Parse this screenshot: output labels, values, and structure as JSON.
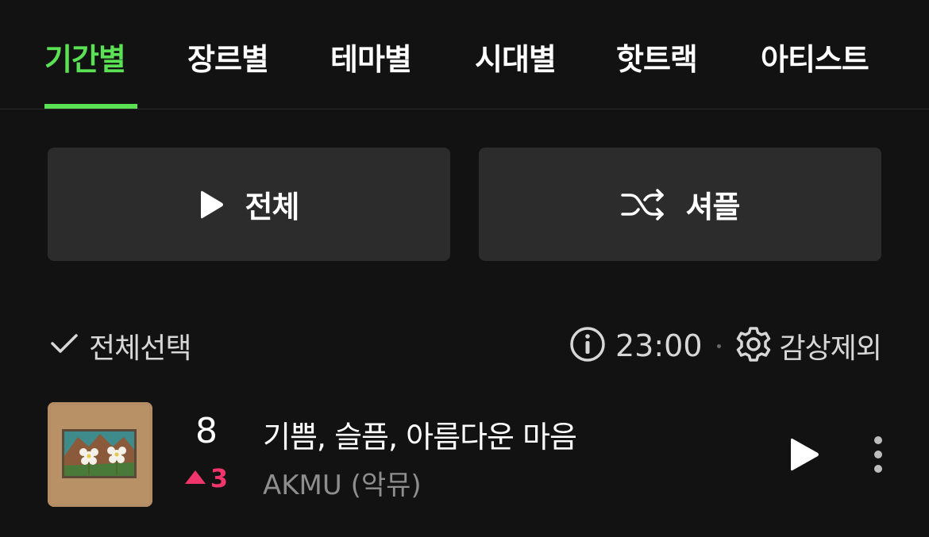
{
  "tabs": [
    {
      "label": "기간별",
      "active": true
    },
    {
      "label": "장르별",
      "active": false
    },
    {
      "label": "테마별",
      "active": false
    },
    {
      "label": "시대별",
      "active": false
    },
    {
      "label": "핫트랙",
      "active": false
    },
    {
      "label": "아티스트",
      "active": false
    }
  ],
  "actions": {
    "play_all_label": "전체",
    "shuffle_label": "셔플"
  },
  "toolbar": {
    "select_all_label": "전체선택",
    "duration": "23:00",
    "exclude_label": "감상제외"
  },
  "song": {
    "rank": "8",
    "rank_change": "3",
    "rank_change_direction": "up",
    "title": "기쁨, 슬픔, 아름다운 마음",
    "artist": "AKMU (악뮤)"
  },
  "colors": {
    "accent": "#5be254",
    "rank_up": "#f0356c",
    "background": "#121212",
    "button_bg": "#2c2c2c"
  },
  "icons": {
    "play_all": "play-icon",
    "shuffle": "shuffle-icon",
    "select_all": "check-icon",
    "info": "info-icon",
    "exclude": "gear-icon",
    "row_play": "play-icon",
    "row_more": "more-vertical-icon"
  }
}
